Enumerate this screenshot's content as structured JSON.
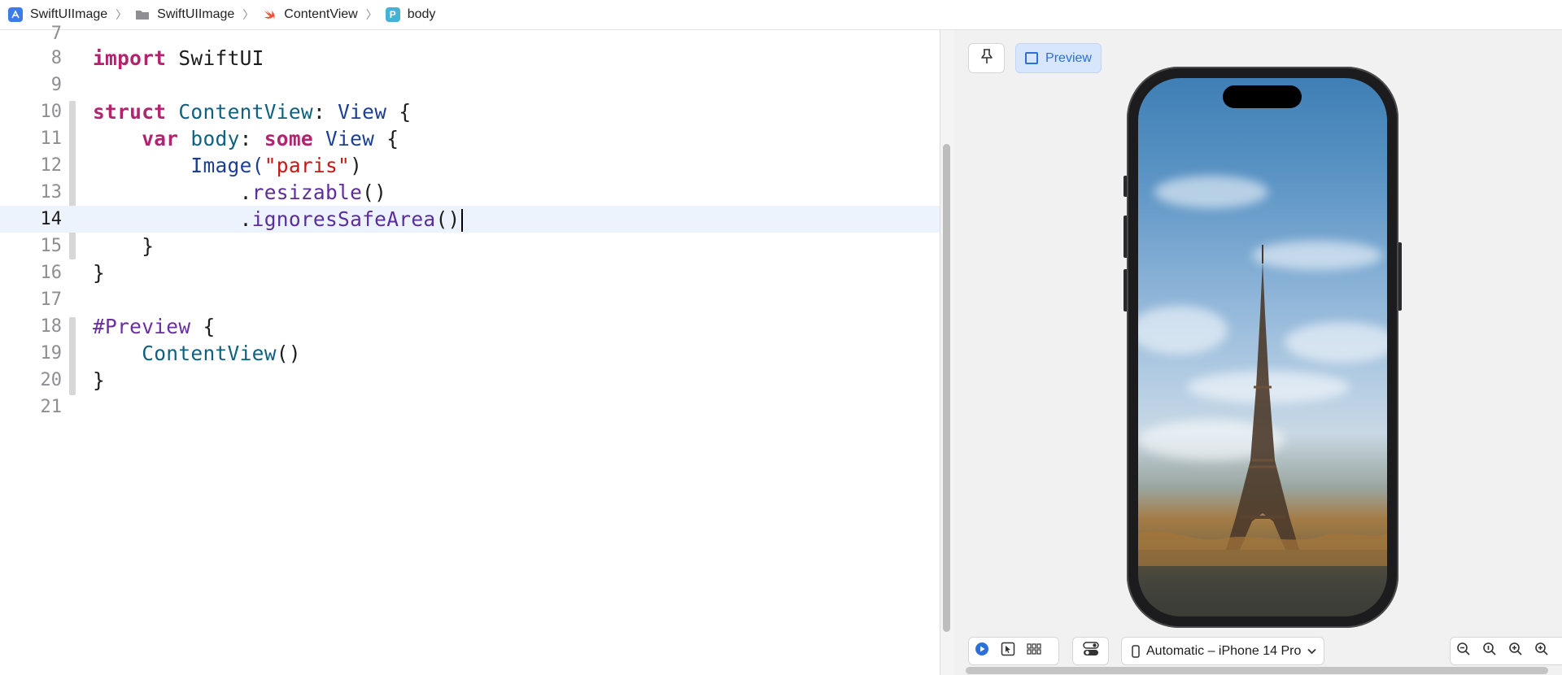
{
  "breadcrumb": {
    "items": [
      {
        "label": "SwiftUIImage",
        "icon": "app-project-icon"
      },
      {
        "label": "SwiftUIImage",
        "icon": "folder-icon"
      },
      {
        "label": "ContentView",
        "icon": "swift-file-icon"
      },
      {
        "label": "body",
        "icon": "property-icon",
        "icon_letter": "P"
      }
    ]
  },
  "editor": {
    "current_line": 14,
    "lines": [
      {
        "n": "7"
      },
      {
        "n": "8",
        "tokens": [
          "import",
          "SwiftUI"
        ]
      },
      {
        "n": "9"
      },
      {
        "n": "10",
        "tokens": [
          "struct",
          "ContentView",
          ":",
          "View",
          "{"
        ]
      },
      {
        "n": "11",
        "tokens": [
          "var",
          "body",
          ":",
          "some",
          "View",
          "{"
        ]
      },
      {
        "n": "12",
        "tokens": [
          "Image(",
          "\"paris\"",
          ")"
        ]
      },
      {
        "n": "13",
        "tokens": [
          ".",
          "resizable",
          "()"
        ]
      },
      {
        "n": "14",
        "tokens": [
          ".",
          "ignoresSafeArea",
          "()"
        ]
      },
      {
        "n": "15",
        "tokens": [
          "}"
        ]
      },
      {
        "n": "16",
        "tokens": [
          "}"
        ]
      },
      {
        "n": "17"
      },
      {
        "n": "18",
        "tokens": [
          "#Preview",
          "{"
        ]
      },
      {
        "n": "19",
        "tokens": [
          "ContentView",
          "()"
        ]
      },
      {
        "n": "20",
        "tokens": [
          "}"
        ]
      },
      {
        "n": "21"
      }
    ]
  },
  "canvas": {
    "pin_icon": "pin-icon",
    "preview_label": "Preview",
    "device_label": "Automatic – iPhone 14 Pro",
    "toolbar_icons": [
      "live-play-icon",
      "selectable-cursor-icon",
      "variants-grid-icon",
      "device-settings-icon",
      "zoom-out-icon",
      "zoom-actual-icon",
      "zoom-in-icon",
      "zoom-fit-icon"
    ]
  },
  "colors": {
    "keyword": "#b2246f",
    "type": "#1c3f93",
    "string": "#c41a16",
    "method": "#5b2d9e",
    "accent": "#2d6fd8",
    "current_line": "#edf3fd"
  }
}
